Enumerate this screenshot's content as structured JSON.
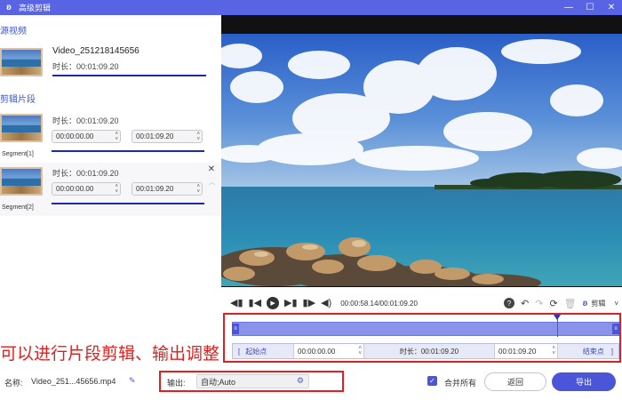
{
  "window": {
    "title": "高级剪辑",
    "logo_icon": "app-logo-icon",
    "buttons": [
      "minimize",
      "maximize",
      "close"
    ],
    "button_glyphs": [
      "—",
      "☐",
      "✕"
    ]
  },
  "left_panel": {
    "source_section_title": "源视频",
    "source": {
      "name": "Video_251218145656",
      "duration": "时长：00:01:09.20"
    },
    "segments_section_title": "剪辑片段",
    "segments": [
      {
        "label": "Segment[1]",
        "duration": "时长：00:01:09.20",
        "start": "00:00:00.00",
        "end": "00:01:09.20"
      },
      {
        "label": "Segment[2]",
        "duration": "时长：00:01:09.20",
        "start": "00:00:00.00",
        "end": "00:01:09.20"
      }
    ]
  },
  "player": {
    "current_time": "00:00:58.14/00:01:09.20",
    "edit_label": "剪辑",
    "playhead_fraction": 0.84
  },
  "segment_row": {
    "start_label": "起始点",
    "start_value": "00:00:00.00",
    "duration_label": "时长：00:01:09.20",
    "end_value": "00:01:09.20",
    "end_label": "结束点"
  },
  "annotation": "可以进行片段剪辑、输出调整",
  "bottom": {
    "name_label": "名称:",
    "name_value": "Video_251...45656.mp4",
    "output_label": "输出:",
    "output_value": "自动;Auto",
    "merge_label": "合并所有",
    "merge_checked": true,
    "back_label": "返回",
    "export_label": "导出"
  },
  "colors": {
    "accent": "#4a55d8",
    "titlebar": "#5864e4",
    "highlight_red": "#e02020",
    "timeline": "#8a93ea"
  }
}
